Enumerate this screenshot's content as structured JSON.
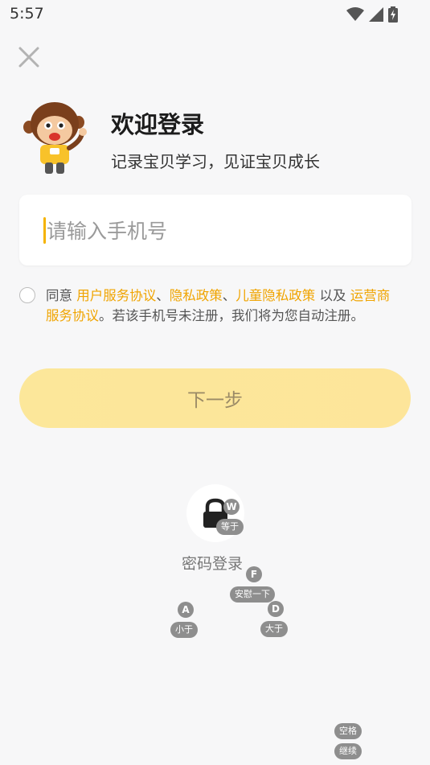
{
  "status_bar": {
    "time": "5:57"
  },
  "welcome": {
    "title": "欢迎登录",
    "subtitle": "记录宝贝学习，见证宝贝成长"
  },
  "phone": {
    "placeholder": "请输入手机号",
    "value": ""
  },
  "agreement": {
    "prefix": "同意 ",
    "link_user_service": "用户服务协议",
    "sep1": "、",
    "link_privacy": "隐私政策",
    "sep2": "、",
    "link_child_privacy": "儿童隐私政策",
    "mid": " 以及 ",
    "link_carrier": "运营商服务协议",
    "suffix": "。若该手机号未注册，我们将为您自动注册。"
  },
  "next_button": {
    "label": "下一步"
  },
  "password_login": {
    "label": "密码登录"
  },
  "key_hints": [
    {
      "key": "W",
      "tip": "等于"
    },
    {
      "key": "F",
      "tip": "安慰一下"
    },
    {
      "key": "A",
      "tip": "小于"
    },
    {
      "key": "D",
      "tip": "大于"
    },
    {
      "key": "空格",
      "tip": "继续"
    }
  ],
  "colors": {
    "accent": "#f0a400",
    "button_bg": "#fde598",
    "caret": "#f5b300"
  }
}
